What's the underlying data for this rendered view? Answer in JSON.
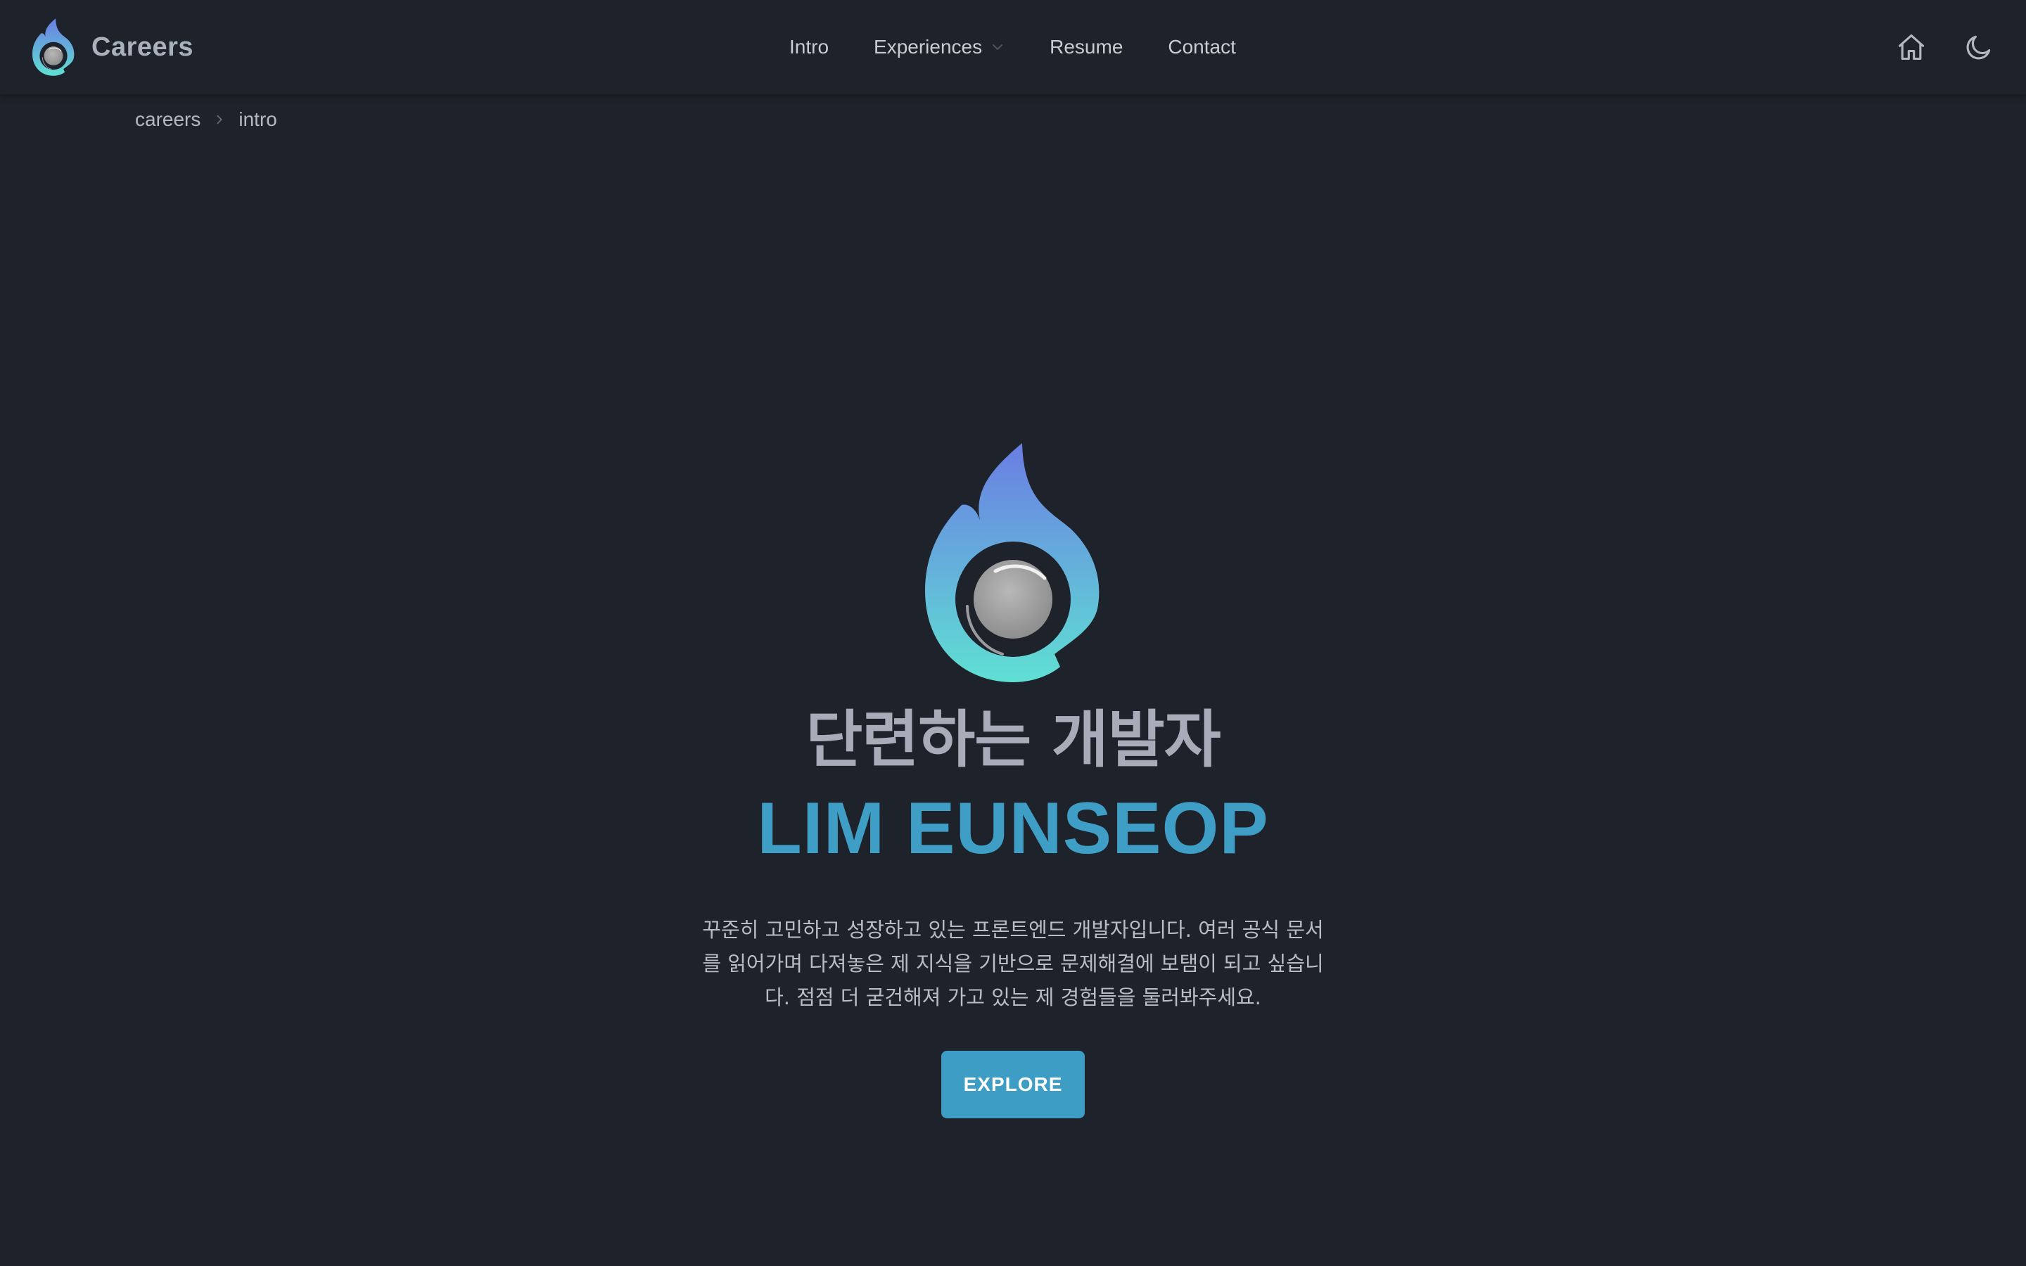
{
  "header": {
    "brand_title": "Careers",
    "logo_icon": "flame-search-logo-icon",
    "nav": [
      {
        "label": "Intro"
      },
      {
        "label": "Experiences",
        "has_dropdown": true
      },
      {
        "label": "Resume"
      },
      {
        "label": "Contact"
      }
    ],
    "right_icons": [
      "home-icon",
      "moon-icon"
    ]
  },
  "breadcrumb": {
    "items": [
      "careers",
      "intro"
    ],
    "separator_icon": "chevron-right-icon"
  },
  "hero": {
    "subtitle": "단련하는 개발자",
    "name": "LIM EUNSEOP",
    "description": "꾸준히 고민하고 성장하고 있는 프론트엔드 개발자입니다. 여러 공식 문서를 읽어가며 다져놓은 제 지식을 기반으로 문제해결에 보탬이 되고 싶습니다. 점점 더 굳건해져 가고 있는 제 경험들을 둘러봐주세요.",
    "button_label": "EXPLORE"
  },
  "colors": {
    "background": "#1e232b",
    "accent": "#3f9ec6",
    "brand_text": "#a9b1bd",
    "gradient_top": "#6a7de3",
    "gradient_bottom": "#5fe0d3"
  }
}
